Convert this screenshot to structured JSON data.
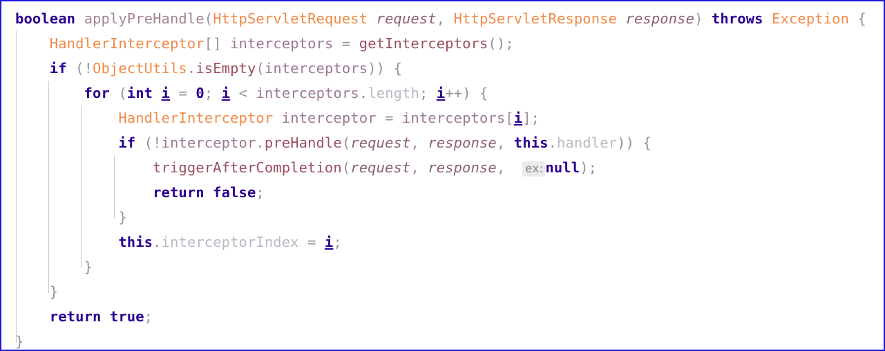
{
  "editor": {
    "language": "java",
    "border_color": "#1a17e0",
    "background_color": "#ffffff",
    "theme": "light",
    "palette": {
      "keyword": "#2b0091",
      "class_name": "#ef8b47",
      "identifier": "#9b7a93",
      "method_call": "#9c4f5e",
      "field": "#b9b9c4",
      "parameter_italic": "#8d5f72",
      "punctuation": "#9a8f9a",
      "inlay_hint_bg": "#ebebeb",
      "inlay_hint_fg": "#8a8a8a",
      "indent_guide": "#c9c9d2"
    }
  },
  "code": {
    "line1": {
      "kw_boolean": "boolean",
      "method_name": "applyPreHandle",
      "paren_open": "(",
      "type_request": "HttpServletRequest",
      "param_request": "request",
      "comma1": ",",
      "type_response": "HttpServletResponse",
      "param_response": "response",
      "paren_close": ")",
      "kw_throws": "throws",
      "type_exception": "Exception",
      "brace_open": "{"
    },
    "line2": {
      "type": "HandlerInterceptor",
      "brackets": "[]",
      "var": "interceptors",
      "equals": "=",
      "call": "getInterceptors",
      "parens": "()",
      "semi": ";"
    },
    "line3": {
      "kw_if": "if",
      "open": "(!",
      "type": "ObjectUtils",
      "dot": ".",
      "call": "isEmpty",
      "arg_open": "(",
      "arg": "interceptors",
      "close": "))",
      "brace_open": "{"
    },
    "line4": {
      "kw_for": "for",
      "paren_open": "(",
      "kw_int": "int",
      "var_i": "i",
      "equals": "=",
      "zero": "0",
      "semi1": ";",
      "var_i2": "i",
      "lt": "<",
      "arr": "interceptors",
      "dot": ".",
      "length": "length",
      "semi2": ";",
      "var_i3": "i",
      "incr": "++",
      "paren_close": ")",
      "brace_open": "{"
    },
    "line5": {
      "type": "HandlerInterceptor",
      "var": "interceptor",
      "equals": "=",
      "arr": "interceptors",
      "bracket_open": "[",
      "index": "i",
      "bracket_close": "]",
      "semi": ";"
    },
    "line6": {
      "kw_if": "if",
      "open": "(!",
      "obj": "interceptor",
      "dot": ".",
      "call": "preHandle",
      "arg_open": "(",
      "arg1": "request",
      "comma1": ",",
      "arg2": "response",
      "comma2": ",",
      "kw_this": "this",
      "dot2": ".",
      "field": "handler",
      "close": "))",
      "brace_open": "{"
    },
    "line7": {
      "call": "triggerAfterCompletion",
      "arg_open": "(",
      "arg1": "request",
      "comma1": ",",
      "arg2": "response",
      "comma2": ",",
      "hint_label": "ex:",
      "kw_null": "null",
      "close": ")",
      "semi": ";"
    },
    "line8": {
      "kw_return": "return",
      "kw_false": "false",
      "semi": ";"
    },
    "line9": {
      "brace_close": "}"
    },
    "line10": {
      "kw_this": "this",
      "dot": ".",
      "field": "interceptorIndex",
      "equals": "=",
      "var_i": "i",
      "semi": ";"
    },
    "line11": {
      "brace_close": "}"
    },
    "line12": {
      "brace_close": "}"
    },
    "line13": {
      "kw_return": "return",
      "kw_true": "true",
      "semi": ";"
    },
    "line14": {
      "brace_close": "}"
    }
  }
}
